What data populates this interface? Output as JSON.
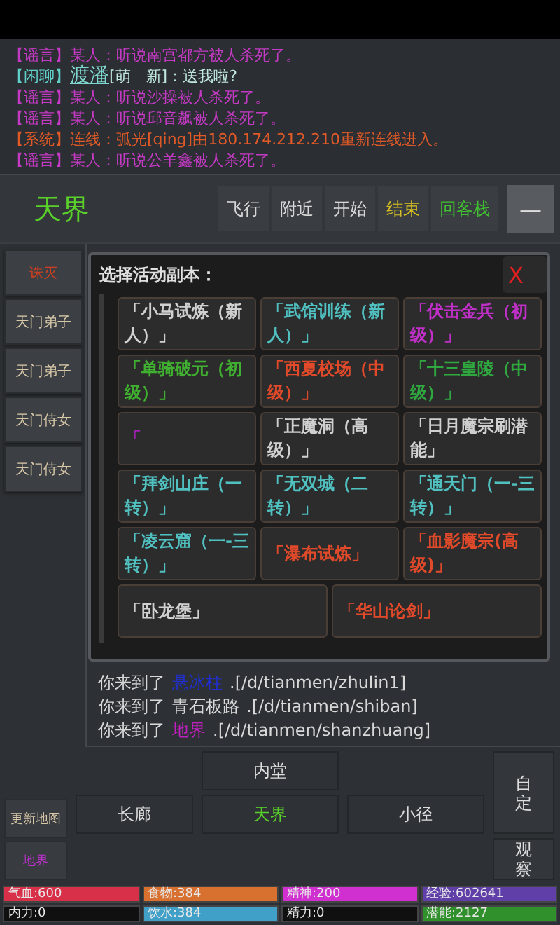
{
  "chat": [
    {
      "kind": "rumor",
      "channel": "【谣言】",
      "text": "某人：听说南宫都方被人杀死了。"
    },
    {
      "kind": "chat",
      "channel": "【闲聊】",
      "speaker": "渡潘",
      "text": "[萌　新]：送我啦?"
    },
    {
      "kind": "rumor",
      "channel": "【谣言】",
      "text": "某人：听说沙操被人杀死了。"
    },
    {
      "kind": "rumor",
      "channel": "【谣言】",
      "text": "某人：听说邱音飙被人杀死了。"
    },
    {
      "kind": "system",
      "channel": "【系统】",
      "text": "连线：弧光[qing]由180.174.212.210重新连线进入。"
    },
    {
      "kind": "rumor",
      "channel": "【谣言】",
      "text": "某人：听说公羊鑫被人杀死了。"
    }
  ],
  "header": {
    "location": "天界",
    "actions": [
      {
        "label": "飞行",
        "color": "#d8d8d8"
      },
      {
        "label": "附近",
        "color": "#d8d8d8"
      },
      {
        "label": "开始",
        "color": "#d8d8d8"
      },
      {
        "label": "结束",
        "color": "#d8c020"
      },
      {
        "label": "回客栈",
        "color": "#40c030"
      }
    ],
    "menu": "—"
  },
  "sidebar": [
    {
      "label": "诛灭",
      "color": "#d04020"
    },
    {
      "label": "天门弟子",
      "color": "#d8c8a8"
    },
    {
      "label": "天门弟子",
      "color": "#d8c8a8"
    },
    {
      "label": "天门侍女",
      "color": "#d8c8a8"
    },
    {
      "label": "天门侍女",
      "color": "#d8c8a8"
    }
  ],
  "dialog": {
    "title": "选择活动副本：",
    "close": "X",
    "instances": [
      {
        "label": "「小马试炼（新人）」",
        "color": "#d0d0d0"
      },
      {
        "label": "「武馆训练（新人）」",
        "color": "#50c0c0"
      },
      {
        "label": "「伏击金兵（初级）」",
        "color": "#c030c8"
      },
      {
        "label": "「单骑破元（初级）」",
        "color": "#40b030"
      },
      {
        "label": "「西夏校场（中级）」",
        "color": "#e04a2a"
      },
      {
        "label": "「十三皇陵（中级）」",
        "color": "#30a840"
      },
      {
        "label": "「",
        "color": "#a020b0"
      },
      {
        "label": "「正魔洞（高级）」",
        "color": "#d0d0d0"
      },
      {
        "label": "「日月魔宗刷潜能」",
        "color": "#d0d0d0"
      },
      {
        "label": "「拜剑山庄（一转）」",
        "color": "#50c0c0"
      },
      {
        "label": "「无双城（二转）」",
        "color": "#50c0c0"
      },
      {
        "label": "「通天门（一-三转）」",
        "color": "#50c0c0"
      },
      {
        "label": "「凌云窟（一-三转）」",
        "color": "#50c0c0"
      },
      {
        "label": "「瀑布试炼」",
        "color": "#e04a2a"
      },
      {
        "label": "「血影魔宗(高级)」",
        "color": "#e04a2a"
      },
      {
        "label": "「卧龙堡」",
        "color": "#d0d0d0"
      },
      {
        "label": "「华山论剑」",
        "color": "#e04a2a"
      }
    ]
  },
  "room_log": [
    {
      "prefix": "你来到了",
      "place": "悬冰柱",
      "path": ".[/d/tianmen/zhulin1]",
      "color": "#2030d0"
    },
    {
      "prefix": "你来到了",
      "place": "青石板路",
      "path": ".[/d/tianmen/shiban]",
      "color": "#d8d8d8"
    },
    {
      "prefix": "你来到了",
      "place": "地界",
      "path": ".[/d/tianmen/shanzhuang]",
      "color": "#c020c0"
    }
  ],
  "map": {
    "update": "更新地图",
    "current_area": "地界",
    "exits": [
      {
        "label": "内堂",
        "current": false
      },
      {
        "label": "长廊",
        "current": false
      },
      {
        "label": "天界",
        "current": true
      },
      {
        "label": "小径",
        "current": false
      }
    ],
    "side_buttons": [
      "自定",
      "观察"
    ]
  },
  "stats": [
    {
      "label": "气血:600",
      "color": "#d83048"
    },
    {
      "label": "食物:384",
      "color": "#d87030"
    },
    {
      "label": "精神:200",
      "color": "#d030d0"
    },
    {
      "label": "经验:602641",
      "color": "#6040a8"
    },
    {
      "label": "内力:0",
      "color": "#101010"
    },
    {
      "label": "饮水:384",
      "color": "#40a0c8"
    },
    {
      "label": "精力:0",
      "color": "#101010"
    },
    {
      "label": "潜能:2127",
      "color": "#30902c"
    }
  ]
}
